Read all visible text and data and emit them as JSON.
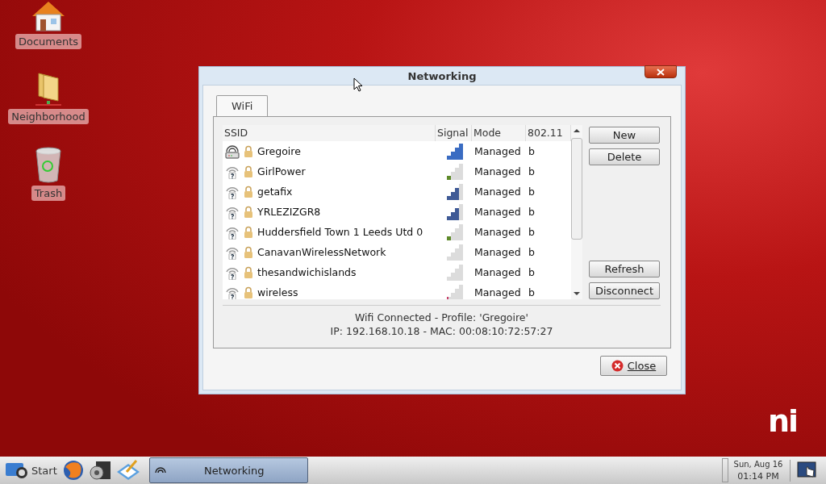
{
  "desktop_icons": [
    {
      "kind": "home",
      "label": "Documents"
    },
    {
      "kind": "folder",
      "label": "Neighborhood"
    },
    {
      "kind": "trash",
      "label": "Trash"
    }
  ],
  "logo": "ni",
  "window": {
    "title": "Networking",
    "tabs": [
      {
        "label": "WiFi",
        "selected": true
      }
    ],
    "columns": [
      "SSID",
      "Signal",
      "Mode",
      "802.11"
    ],
    "networks": [
      {
        "kind": "connected",
        "locked": true,
        "ssid": "Gregoire",
        "level": 1,
        "color": "#3a6cc2",
        "mode": "Managed",
        "standard": "b"
      },
      {
        "kind": "unknown",
        "locked": true,
        "ssid": "GirlPower",
        "level": 0.25,
        "color": "#5e8a2a",
        "mode": "Managed",
        "standard": "b"
      },
      {
        "kind": "unknown",
        "locked": true,
        "ssid": "getafix",
        "level": 0.75,
        "color": "#3f5a96",
        "mode": "Managed",
        "standard": "b"
      },
      {
        "kind": "unknown",
        "locked": true,
        "ssid": "YRLEZIZGR8",
        "level": 0.75,
        "color": "#3f5a96",
        "mode": "Managed",
        "standard": "b"
      },
      {
        "kind": "unknown",
        "locked": true,
        "ssid": "Huddersfield Town 1 Leeds Utd 0",
        "level": 0.25,
        "color": "#5e8a2a",
        "mode": "Managed",
        "standard": "b"
      },
      {
        "kind": "unknown",
        "locked": true,
        "ssid": "CanavanWirelessNetwork",
        "level": 0,
        "mode": "Managed",
        "standard": "b"
      },
      {
        "kind": "unknown",
        "locked": true,
        "ssid": "thesandwichislands",
        "level": 0,
        "mode": "Managed",
        "standard": "b"
      },
      {
        "kind": "unknown",
        "locked": true,
        "ssid": "wireless",
        "level": 0.1,
        "color": "#c8406a",
        "mode": "Managed",
        "standard": "b"
      }
    ],
    "top_buttons": [
      "New",
      "Delete"
    ],
    "bottom_buttons": [
      "Refresh",
      "Disconnect"
    ],
    "status_lines": [
      "Wifi Connected - Profile: 'Gregoire'",
      "IP: 192.168.10.18 - MAC: 00:08:10:72:57:27"
    ],
    "close_button": "Close"
  },
  "taskbar": {
    "start": "Start",
    "tasks": [
      {
        "label": "Networking",
        "selected": true
      }
    ],
    "date": "Sun, Aug 16",
    "time": "01:14 PM"
  }
}
